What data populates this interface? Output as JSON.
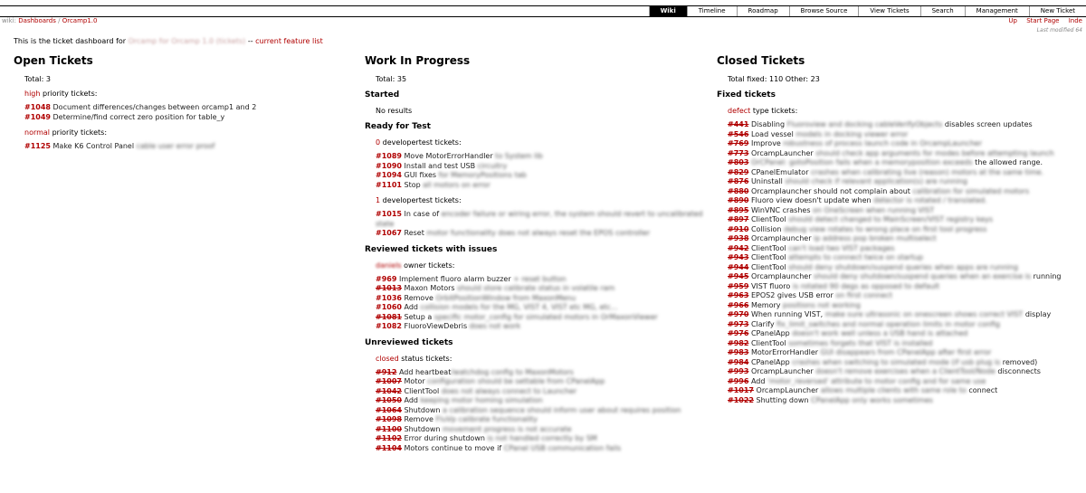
{
  "nav": {
    "items": [
      "Wiki",
      "Timeline",
      "Roadmap",
      "Browse Source",
      "View Tickets",
      "Search",
      "Management",
      "New Ticket"
    ],
    "active": "Wiki"
  },
  "breadcrumb": {
    "prefix": "wiki:",
    "dashboards": "Dashboards",
    "sep": "/",
    "page": "Orcamp1.0"
  },
  "ctxnav": [
    "Up",
    "Start Page",
    "Inde"
  ],
  "last_modified": "Last modified 64",
  "intro": {
    "text": "This is the ticket dashboard for",
    "blurred": "Orcamp for Orcamp 1.0 (tickets)",
    "sep": "--",
    "link": "current feature list"
  },
  "open": {
    "title": "Open Tickets",
    "total": "Total: 3",
    "groups": [
      {
        "label": "high",
        "suffix": " priority tickets:",
        "tickets": [
          {
            "num": "#1048",
            "text": "Document differences/changes between orcamp1 and 2",
            "blur": ""
          },
          {
            "num": "#1049",
            "text": "Determine/find correct zero position for table_y",
            "blur": ""
          }
        ]
      },
      {
        "label": "normal",
        "suffix": " priority tickets:",
        "tickets": [
          {
            "num": "#1125",
            "text": "Make K6 Control Panel",
            "blur": " cable user error proof"
          }
        ]
      }
    ]
  },
  "wip": {
    "title": "Work In Progress",
    "total": "Total: 35",
    "started": {
      "heading": "Started",
      "text": "No results"
    },
    "ready": {
      "heading": "Ready for Test",
      "groups": [
        {
          "label": "0",
          "suffix": " developertest tickets:",
          "tickets": [
            {
              "num": "#1089",
              "text": "Move MotorErrorHandler",
              "blur": " to System lib"
            },
            {
              "num": "#1090",
              "text": "Install and test USB",
              "blur": " circuitry"
            },
            {
              "num": "#1094",
              "text": "GUI fixes",
              "blur": " for MemoryPositions tab"
            },
            {
              "num": "#1101",
              "text": "Stop",
              "blur": " all motors on error"
            }
          ]
        },
        {
          "label": "1",
          "suffix": " developertest tickets:",
          "tickets": [
            {
              "num": "#1015",
              "text": "In case of",
              "blur": " encoder failure or wiring error, the system should revert to uncalibrated state"
            },
            {
              "num": "#1067",
              "text": "Reset",
              "blur": " motor functionality does not always reset the EPOS controller"
            }
          ]
        }
      ]
    },
    "reviewed": {
      "heading": "Reviewed tickets with issues",
      "owner": "daniels",
      "suffix": " owner tickets:",
      "tickets": [
        {
          "num": "#969",
          "text": "Implement fluoro alarm buzzer",
          "blur": " + reset button",
          "closed": false
        },
        {
          "num": "#1013",
          "text": "Maxon Motors",
          "blur": " should store calibrate status in volatile ram",
          "closed": true
        },
        {
          "num": "#1036",
          "text": "Remove",
          "blur": " OrbitPositionWindow from MaxonMenu",
          "closed": false
        },
        {
          "num": "#1060",
          "text": "Add",
          "blur": " collision models for the MG, VIST 4, VIST etc MG, etc...",
          "closed": false
        },
        {
          "num": "#1081",
          "text": "Setup a",
          "blur": " specific motor_config for simulated motors in OrMaxonViewer",
          "closed": true
        },
        {
          "num": "#1082",
          "text": "FluoroViewDebris",
          "blur": " does not work",
          "closed": false
        }
      ]
    },
    "unreviewed": {
      "heading": "Unreviewed tickets",
      "label": "closed",
      "suffix": " status tickets:",
      "tickets": [
        {
          "num": "#912",
          "text": "Add heartbeat",
          "blur": "/watchdog config to MaxonMotors"
        },
        {
          "num": "#1007",
          "text": "Motor",
          "blur": " configuration should be settable from CPanelApp"
        },
        {
          "num": "#1042",
          "text": "ClientTool",
          "blur": " does not always connect to Launcher"
        },
        {
          "num": "#1050",
          "text": "Add",
          "blur": " keeping motor homing simulation"
        },
        {
          "num": "#1064",
          "text": "Shutdown",
          "blur": " a calibration sequence should inform user about requires position"
        },
        {
          "num": "#1098",
          "text": "Remove",
          "blur": " FluVp calibrate functionality"
        },
        {
          "num": "#1100",
          "text": "Shutdown",
          "blur": " movement progress is not accurate"
        },
        {
          "num": "#1102",
          "text": "Error during shutdown",
          "blur": " is not handled correctly by SM"
        },
        {
          "num": "#1104",
          "text": "Motors continue to move if",
          "blur": " CPanel USB communication fails"
        }
      ]
    }
  },
  "closed": {
    "title": "Closed Tickets",
    "total": "Total fixed: 110 Other: 23",
    "heading": "Fixed tickets",
    "label": "defect",
    "suffix": " type tickets:",
    "tickets": [
      {
        "num": "#441",
        "text": "Disabling",
        "blur": " Fluoroview and docking cableVerifyObjects",
        "tail": "disables screen updates"
      },
      {
        "num": "#546",
        "text": "Load vessel",
        "blur": " models in docking viewer error",
        "tail": ""
      },
      {
        "num": "#769",
        "text": "Improve",
        "blur": " robustness of process launch code in OrcampLauncher",
        "tail": ""
      },
      {
        "num": "#773",
        "text": "OrcampLauncher",
        "blur": " should check app arguments for modes before attempting launch",
        "tail": ""
      },
      {
        "num": "#803",
        "text": "",
        "blur": "OrCPanel: gotoPosition fails when a memoryposition exceeds",
        "tail": "the allowed range."
      },
      {
        "num": "#829",
        "text": "CPanelEmulator",
        "blur": " crashes when calibrating live (reason) motors at the same time.",
        "tail": ""
      },
      {
        "num": "#876",
        "text": "Uninstall",
        "blur": " should check if relevant application(s) are running",
        "tail": ""
      },
      {
        "num": "#880",
        "text": "Orcamplauncher should not complain about",
        "blur": " calibration for simulated motors",
        "tail": ""
      },
      {
        "num": "#890",
        "text": "Fluoro view doesn't update when",
        "blur": " detector is rotated / translated.",
        "tail": ""
      },
      {
        "num": "#895",
        "text": "WinVNC crashes",
        "blur": " on OneScreen when running VIST",
        "tail": ""
      },
      {
        "num": "#897",
        "text": "ClientTool",
        "blur": " should detect changed to MainScreen/VIST registry keys",
        "tail": ""
      },
      {
        "num": "#910",
        "text": "Collision",
        "blur": " debug view rotates to wrong place on first tool progress",
        "tail": ""
      },
      {
        "num": "#938",
        "text": "Orcamplauncher",
        "blur": " ip address pop broken multiselect",
        "tail": ""
      },
      {
        "num": "#942",
        "text": "ClientTool",
        "blur": " can't load two VIST packages",
        "tail": ""
      },
      {
        "num": "#943",
        "text": "ClientTool",
        "blur": " attempts to connect twice on startup",
        "tail": ""
      },
      {
        "num": "#944",
        "text": "ClientTool",
        "blur": " should deny shutdown/suspend queries when apps are running",
        "tail": ""
      },
      {
        "num": "#945",
        "text": "Orcamplauncher",
        "blur": " should deny shutdown/suspend queries when an exercise is",
        "tail": "running"
      },
      {
        "num": "#959",
        "text": "VIST fluoro",
        "blur": " is rotated 90 degs as opposed to default",
        "tail": ""
      },
      {
        "num": "#963",
        "text": "EPOS2 gives USB error",
        "blur": " on first connect",
        "tail": ""
      },
      {
        "num": "#966",
        "text": "Memory",
        "blur": " positions not working",
        "tail": ""
      },
      {
        "num": "#970",
        "text": "When running VIST,",
        "blur": " make sure ultrasonic on onescreen shows correct VIST",
        "tail": "display"
      },
      {
        "num": "#973",
        "text": "Clarify",
        "blur": " fix_limit_switches and normal operation limits in motor config",
        "tail": ""
      },
      {
        "num": "#976",
        "text": "CPanelApp",
        "blur": " doesn't work well unless a USB hand is attached",
        "tail": ""
      },
      {
        "num": "#982",
        "text": "ClientTool",
        "blur": " sometimes forgets that VIST is installed",
        "tail": ""
      },
      {
        "num": "#983",
        "text": "MotorErrorHandler",
        "blur": " GUI disappears from CPanelApp after first error",
        "tail": ""
      },
      {
        "num": "#984",
        "text": "CPanelApp",
        "blur": " crashes when switching to simulated mode (if usb plug is",
        "tail": "removed)"
      },
      {
        "num": "#993",
        "text": "OrcampLauncher",
        "blur": " doesn't remove exercises when a ClientTool/Node",
        "tail": "disconnects"
      },
      {
        "num": "#996",
        "text": "Add",
        "blur": " 'motor_reversed' attribute to motor config and for same use",
        "tail": ""
      },
      {
        "num": "#1017",
        "text": "OrcampLauncher",
        "blur": " allows multiple clients with same role to",
        "tail": "connect"
      },
      {
        "num": "#1022",
        "text": "Shutting down",
        "blur": " CPanelApp only works sometimes",
        "tail": ""
      }
    ]
  }
}
